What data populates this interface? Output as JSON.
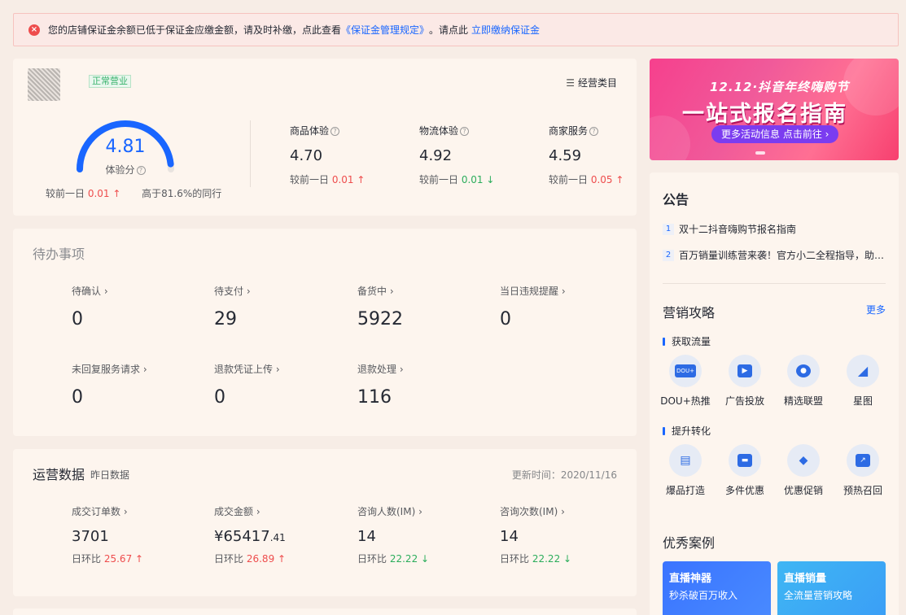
{
  "alert": {
    "icon": "error-icon",
    "text_before": "您的店铺保证金余额已低于保证金应缴金额，请及时补缴，点此查看",
    "rule_link": "《保证金管理规定》",
    "text_middle": "。请点此",
    "pay_link": "立即缴纳保证金"
  },
  "score_card": {
    "shop_status": "正常营业",
    "category_link": "经营类目",
    "experience_score": {
      "value": "4.81",
      "label": "体验分",
      "gauge_fraction": 0.962
    },
    "compare_prefix": "较前一日",
    "compare_value": "0.01",
    "peer_text": "高于81.6%的同行",
    "metrics": [
      {
        "label": "商品体验",
        "value": "4.70",
        "compare_prefix": "较前一日",
        "delta": "0.01",
        "direction": "up"
      },
      {
        "label": "物流体验",
        "value": "4.92",
        "compare_prefix": "较前一日",
        "delta": "0.01",
        "direction": "down"
      },
      {
        "label": "商家服务",
        "value": "4.59",
        "compare_prefix": "较前一日",
        "delta": "0.05",
        "direction": "up"
      }
    ]
  },
  "todo": {
    "title": "待办事项",
    "items": [
      {
        "label": "待确认 ›",
        "value": "0"
      },
      {
        "label": "待支付 ›",
        "value": "29"
      },
      {
        "label": "备货中 ›",
        "value": "5922"
      },
      {
        "label": "当日违规提醒 ›",
        "value": "0"
      },
      {
        "label": "未回复服务请求 ›",
        "value": "0"
      },
      {
        "label": "退款凭证上传 ›",
        "value": "0"
      },
      {
        "label": "退款处理 ›",
        "value": "116"
      }
    ]
  },
  "ops": {
    "title": "运营数据",
    "subtitle": "昨日数据",
    "updated": "更新时间：2020/11/16",
    "compare_prefix": "日环比",
    "items": [
      {
        "label": "成交订单数 ›",
        "value": "3701",
        "delta": "25.67",
        "direction": "up"
      },
      {
        "label": "成交金额 ›",
        "value_main": "¥65417",
        "value_decimal": ".41",
        "delta": "26.89",
        "direction": "up"
      },
      {
        "label": "咨询人数(IM) ›",
        "value": "14",
        "delta": "22.22",
        "direction": "down"
      },
      {
        "label": "咨询次数(IM) ›",
        "value": "14",
        "delta": "22.22",
        "direction": "down"
      }
    ]
  },
  "banner": {
    "top_text": "12.12·抖音年终嗨购节",
    "main_text": "一站式报名指南",
    "button": "更多活动信息 点击前往 ›"
  },
  "notices": {
    "title": "公告",
    "items": [
      {
        "num": "1",
        "text": "双十二抖音嗨购节报名指南"
      },
      {
        "num": "2",
        "text": "百万销量训练营来袭！官方小二全程指导，助…"
      }
    ]
  },
  "marketing": {
    "title": "营销攻略",
    "more": "更多",
    "traffic": {
      "label": "获取流量",
      "tools": [
        {
          "name": "DOU+热推",
          "icon": "dou-plus-icon",
          "glyph": "DOU+"
        },
        {
          "name": "广告投放",
          "icon": "ad-play-icon",
          "glyph": "▶"
        },
        {
          "name": "精选联盟",
          "icon": "alliance-user-icon",
          "glyph": "●"
        },
        {
          "name": "星图",
          "icon": "star-map-icon",
          "glyph": "◢"
        }
      ]
    },
    "conversion": {
      "label": "提升转化",
      "tools": [
        {
          "name": "爆品打造",
          "icon": "basket-icon",
          "glyph": "▤"
        },
        {
          "name": "多件优惠",
          "icon": "wallet-icon",
          "glyph": "▬"
        },
        {
          "name": "优惠促销",
          "icon": "tag-icon",
          "glyph": "◆"
        },
        {
          "name": "预热召回",
          "icon": "trend-chart-icon",
          "glyph": "↗"
        }
      ]
    }
  },
  "cases": {
    "title": "优秀案例",
    "items": [
      {
        "title": "直播神器",
        "sub": "秒杀破百万收入"
      },
      {
        "title": "直播销量",
        "sub": "全流量营销攻略"
      }
    ]
  }
}
